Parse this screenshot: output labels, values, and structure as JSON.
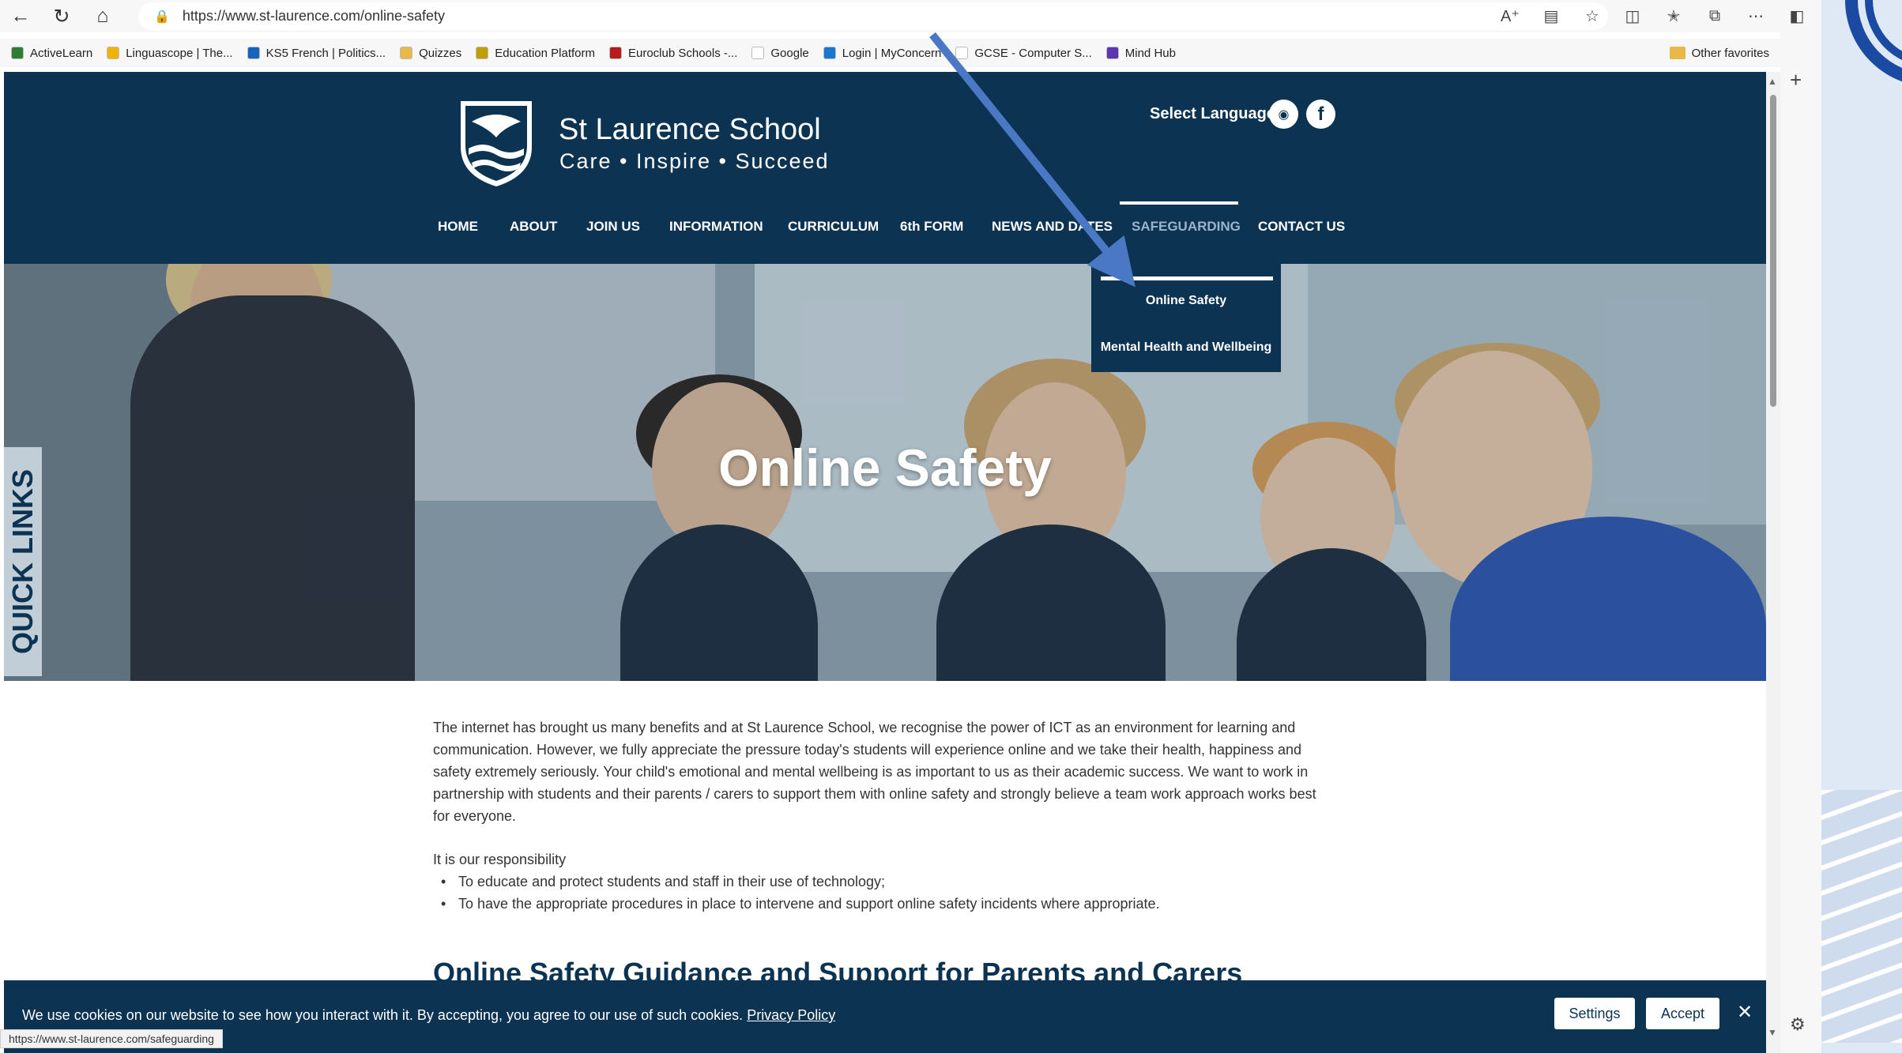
{
  "browser": {
    "url": "https://www.st-laurence.com/online-safety",
    "status_url": "https://www.st-laurence.com/safeguarding",
    "bookmarks": [
      {
        "label": "ActiveLearn",
        "color": "#2e7d32"
      },
      {
        "label": "Linguascope | The...",
        "color": "#f0b400"
      },
      {
        "label": "KS5 French | Politics...",
        "color": "#1565c0"
      },
      {
        "label": "Quizzes",
        "color": "#e8b84a"
      },
      {
        "label": "Education Platform",
        "color": "#c0a000"
      },
      {
        "label": "Euroclub Schools -...",
        "color": "#b71c1c"
      },
      {
        "label": "Google",
        "color": "#ffffff"
      },
      {
        "label": "Login | MyConcern",
        "color": "#1976d2"
      },
      {
        "label": "GCSE - Computer S...",
        "color": "#ffffff"
      },
      {
        "label": "Mind Hub",
        "color": "#5e35b1"
      }
    ],
    "other_favorites": "Other favorites"
  },
  "header": {
    "school_name": "St Laurence School",
    "tagline": "Care • Inspire • Succeed",
    "select_language": "Select Language",
    "instagram_icon": "instagram-icon",
    "facebook_icon": "facebook-icon"
  },
  "nav": [
    {
      "label": "HOME"
    },
    {
      "label": "ABOUT"
    },
    {
      "label": "JOIN US"
    },
    {
      "label": "INFORMATION"
    },
    {
      "label": "CURRICULUM"
    },
    {
      "label": "6th FORM"
    },
    {
      "label": "NEWS AND DATES"
    },
    {
      "label": "SAFEGUARDING"
    },
    {
      "label": "CONTACT US"
    }
  ],
  "dropdown": [
    {
      "label": "Online Safety"
    },
    {
      "label": "Mental Health and Wellbeing"
    }
  ],
  "hero": {
    "title": "Online Safety",
    "quick_links": "QUICK LINKS"
  },
  "content": {
    "intro": "The internet has brought us many benefits and at St Laurence School, we recognise the power of ICT as an environment for learning and communication. However, we fully appreciate the pressure today's students will experience online and we take their health, happiness and safety extremely seriously. Your child's emotional and mental wellbeing is as important to us as their academic success. We want to work in partnership with students and their parents / carers to support them with online safety and strongly believe a team work approach works best for everyone.",
    "responsibility": "It is our responsibility",
    "bullets": [
      "To educate and protect students and staff in their use of technology;",
      "To have the appropriate procedures in place to intervene and support online safety incidents where appropriate."
    ],
    "section_heading": "Online Safety Guidance and Support for Parents and Carers"
  },
  "cookie": {
    "text": "We use cookies on our website to see how you interact with it. By accepting, you agree to our use of such cookies.",
    "privacy_link": "Privacy Policy",
    "settings": "Settings",
    "accept": "Accept"
  },
  "colors": {
    "navy": "#0c3352",
    "arrow": "#4a78c4"
  }
}
